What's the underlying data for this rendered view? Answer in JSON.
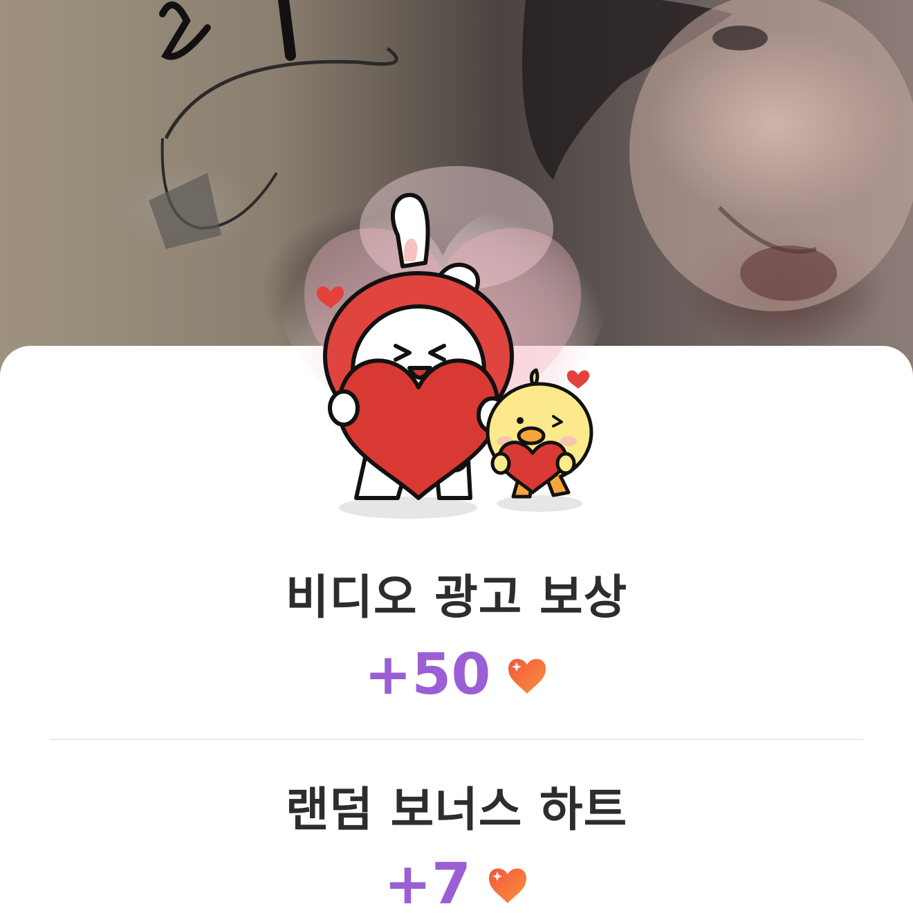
{
  "rewards": [
    {
      "title": "비디오 광고 보상",
      "amount": "+50",
      "icon": "heart-icon"
    },
    {
      "title": "랜덤 보너스 하트",
      "amount": "+7",
      "icon": "heart-icon"
    }
  ],
  "colors": {
    "amount": "#9a5fd4",
    "title": "#2d2d2d",
    "heart": "#f05a3c",
    "sheet": "#ffffff",
    "divider": "#ebebeb"
  },
  "illustration": {
    "icons": [
      "bunny-mascot",
      "chick-mascot",
      "glow-heart",
      "small-heart-icon"
    ]
  }
}
